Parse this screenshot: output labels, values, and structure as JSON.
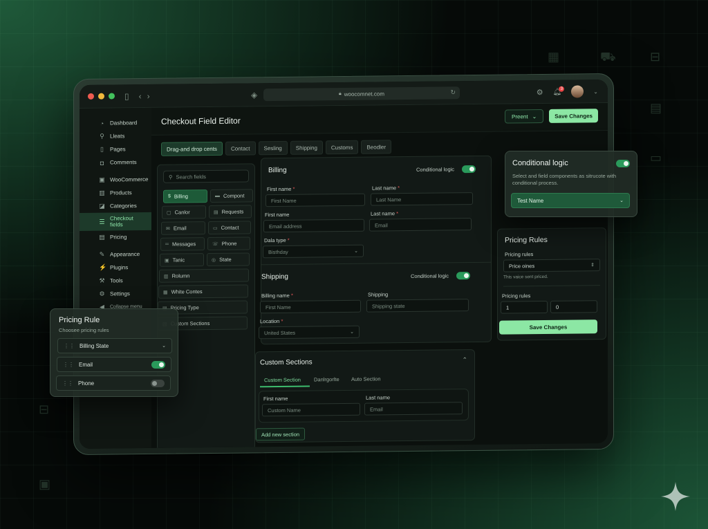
{
  "browser": {
    "url": "woocomnet.com",
    "notification_count": "3"
  },
  "sidebar": {
    "items": [
      {
        "label": "Dashboard",
        "icon": "dashboard-icon"
      },
      {
        "label": "Lleats",
        "icon": "pin-icon"
      },
      {
        "label": "Pages",
        "icon": "page-icon"
      },
      {
        "label": "Comments",
        "icon": "comment-icon"
      },
      {
        "label": "WooCommerce",
        "icon": "woo-icon"
      },
      {
        "label": "Products",
        "icon": "box-icon"
      },
      {
        "label": "Categories",
        "icon": "tag-icon"
      },
      {
        "label": "Checkout fields",
        "icon": "list-icon"
      },
      {
        "label": "Pricing",
        "icon": "pricing-icon"
      },
      {
        "label": "Appearance",
        "icon": "brush-icon"
      },
      {
        "label": "Plugins",
        "icon": "plug-icon"
      },
      {
        "label": "Tools",
        "icon": "wrench-icon"
      },
      {
        "label": "Settings",
        "icon": "settings-icon"
      }
    ],
    "collapse_label": "Collapse menu"
  },
  "header": {
    "title": "Checkout Field Editor",
    "preset_label": "Preent",
    "save_label": "Save Changes"
  },
  "tabs": [
    "Drag-and drop cents",
    "Contact",
    "Sesling",
    "Shipping",
    "Customs",
    "Beodler"
  ],
  "fields_panel": {
    "search_placeholder": "Search fields",
    "chips": [
      "Billing",
      "Compont",
      "Canlor",
      "Requests",
      "Email",
      "Contact",
      "Messages",
      "Phone",
      "Tanic",
      "State",
      "Rolumn",
      "White Contes",
      "Pricing Type",
      "Custom Sections"
    ]
  },
  "billing": {
    "title": "Billing",
    "conditional_label": "Conditional logic",
    "first_name_label": "First name",
    "first_name_placeholder": "First Name",
    "last_name_label": "Last name",
    "last_name_placeholder": "Last Name",
    "first_name2_label": "First name",
    "email_placeholder": "Email address",
    "last_name2_label": "Last name",
    "email2_placeholder": "Email",
    "data_type_label": "Dala type",
    "data_type_value": "Bisthday"
  },
  "shipping": {
    "title": "Shipping",
    "conditional_label": "Conditional logic",
    "billing_name_label": "Billing name",
    "billing_name_placeholder": "First Name",
    "shipping_label": "Shipping",
    "shipping_placeholder": "Shipping state",
    "location_label": "Location",
    "location_value": "United States"
  },
  "custom_sections": {
    "title": "Custom Sections",
    "tabs": [
      "Custom Section",
      "Danlrgorlte",
      "Auto Section"
    ],
    "first_name_label": "First name",
    "first_name_placeholder": "Custom Name",
    "last_name_label": "Last name",
    "last_name_placeholder": "Email",
    "add_label": "Add new section"
  },
  "pricing_rules": {
    "title": "Pricing Rules",
    "rules_label": "Pricing rules",
    "rules_value": "Price oines",
    "hint": "This vaice sent priced.",
    "rules2_label": "Pricing rules",
    "min_value": "1",
    "max_value": "0",
    "save_label": "Save Changes"
  },
  "conditional_card": {
    "title": "Conditional logic",
    "description": "Select and field components as sitrucote with conditional process.",
    "select_value": "Test Name"
  },
  "pricing_rule_card": {
    "title": "Pricing Rule",
    "subtitle": "Choosee pricing rules",
    "items": [
      {
        "label": "Billing State",
        "type": "select"
      },
      {
        "label": "Email",
        "type": "toggle-on"
      },
      {
        "label": "Phone",
        "type": "toggle-off"
      }
    ]
  },
  "colors": {
    "accent": "#8ce7a4",
    "brand_green": "#1f5a3a",
    "toggle_on": "#2a9a5b"
  }
}
